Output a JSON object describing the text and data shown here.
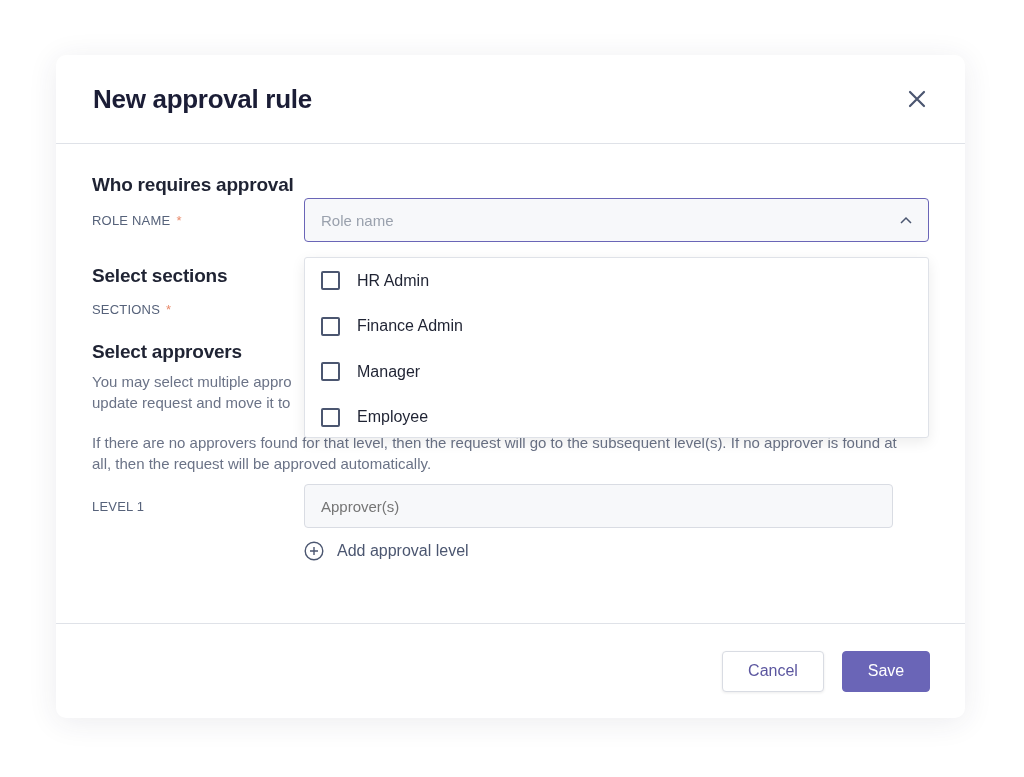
{
  "dialog": {
    "title": "New approval rule"
  },
  "who": {
    "heading": "Who requires approval",
    "label": "ROLE NAME",
    "required_mark": "*",
    "placeholder": "Role name",
    "expanded": true,
    "options": [
      {
        "label": "HR Admin",
        "checked": false
      },
      {
        "label": "Finance Admin",
        "checked": false
      },
      {
        "label": "Manager",
        "checked": false
      },
      {
        "label": "Employee",
        "checked": false
      }
    ]
  },
  "sections": {
    "heading": "Select sections",
    "label": "SECTIONS",
    "required_mark": "*"
  },
  "approvers": {
    "heading": "Select approvers",
    "description_lines": [
      "You may select multiple appro",
      "update request and move it to"
    ],
    "note": "If there are no approvers found for that level, then the request will go to the subsequent level(s). If no approver is found at all, then the request will be approved automatically.",
    "levels": [
      {
        "label": "LEVEL 1",
        "placeholder": "Approver(s)"
      }
    ],
    "add_level": "Add approval level"
  },
  "buttons": [
    {
      "label": "Cancel",
      "kind": "secondary"
    },
    {
      "label": "Save",
      "kind": "primary"
    }
  ]
}
